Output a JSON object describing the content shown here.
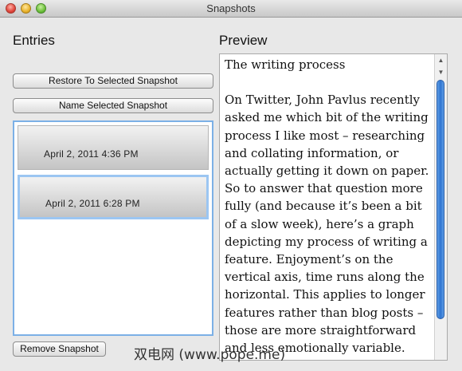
{
  "window": {
    "title": "Snapshots"
  },
  "entries": {
    "heading": "Entries",
    "restore_label": "Restore To Selected Snapshot",
    "name_label": "Name Selected Snapshot",
    "remove_label": "Remove Snapshot",
    "items": [
      {
        "label": "April 2, 2011 4:36 PM"
      },
      {
        "label": "April 2, 2011 6:28 PM"
      }
    ]
  },
  "preview": {
    "heading": "Preview",
    "title_line": "The writing process",
    "body": "On Twitter, John Pavlus recently asked me which bit of the writing process I like most – researching and collating information, or actually getting it down on paper. So to answer that question more fully (and because it’s been a bit of a slow week), here’s a graph depicting my process of writing a feature. Enjoyment’s on the vertical axis, time runs along the horizontal. This applies to longer features rather than blog posts – those are more straightforward and less emotionally variable."
  },
  "watermark": "双电网 (www.pope.me)",
  "icons": {
    "close": "close-traffic-light-icon",
    "minimize": "minimize-traffic-light-icon",
    "maximize": "maximize-traffic-light-icon",
    "scroll_up": "scroll-up-arrow-icon",
    "scroll_down": "scroll-down-arrow-icon"
  },
  "colors": {
    "selection": "#9cc6f2",
    "scroll_thumb": "#2f74d0",
    "close": "#e0443a",
    "minimize": "#e8b22a",
    "maximize": "#6cbf3a"
  }
}
